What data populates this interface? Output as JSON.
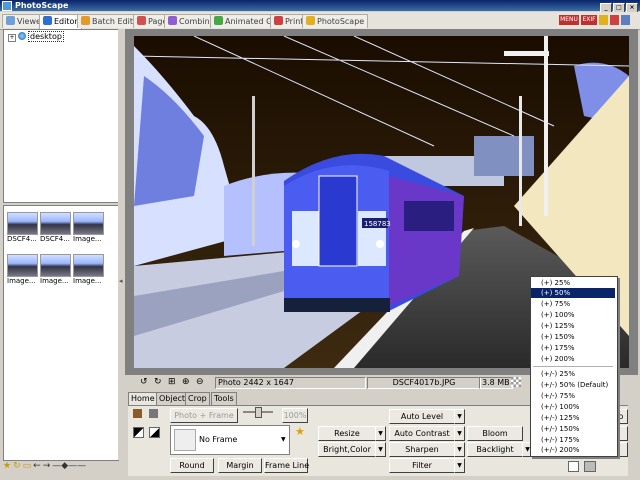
{
  "window": {
    "title": "PhotoScape"
  },
  "tabs": [
    {
      "label": "Viewer",
      "color": "#6f9fd8"
    },
    {
      "label": "Editor",
      "color": "#2e6fd1"
    },
    {
      "label": "Batch Editor",
      "color": "#e39a2b"
    },
    {
      "label": "Page",
      "color": "#d15050"
    },
    {
      "label": "Combine",
      "color": "#8f5fd1"
    },
    {
      "label": "Animated GIF",
      "color": "#45a845"
    },
    {
      "label": "Print",
      "color": "#d14040"
    },
    {
      "label": "PhotoScape",
      "color": "#e0b020"
    }
  ],
  "top_icons": {
    "menu": "MENU",
    "exif": "EXIF"
  },
  "explorer": {
    "root": "desktop"
  },
  "thumbnails": [
    "DSCF4...",
    "DSCF4...",
    "Image...",
    "Image...",
    "Image...",
    "Image..."
  ],
  "status": {
    "dimensions": "Photo 2442 x 1647",
    "filename": "DSCF4017b.JPG",
    "filesize": "3.8 MB"
  },
  "train_number": "158783",
  "edit_tabs": [
    "Home",
    "Object",
    "Crop",
    "Tools"
  ],
  "home": {
    "photo_frame": "Photo + Frame",
    "zoom_pct": "100%",
    "frame_value": "No Frame",
    "round": "Round",
    "margin": "Margin",
    "frame_line": "Frame Line",
    "resize": "Resize",
    "bright_color": "Bright,Color",
    "auto_level": "Auto Level",
    "auto_contrast": "Auto Contrast",
    "sharpen": "Sharpen",
    "filter": "Filter",
    "bloom": "Bloom",
    "backlight": "Backlight",
    "redo_partial": "edo"
  },
  "zoom_menu": {
    "group1": [
      "(+) 25%",
      "(+) 50%",
      "(+) 75%",
      "(+) 100%",
      "(+) 125%",
      "(+) 150%",
      "(+) 175%",
      "(+) 200%"
    ],
    "group2": [
      "(+/-) 25%",
      "(+/-) 50% (Default)",
      "(+/-) 75%",
      "(+/-) 100%",
      "(+/-) 125%",
      "(+/-) 150%",
      "(+/-) 175%",
      "(+/-) 200%"
    ],
    "highlighted": "(+) 50%"
  },
  "colors": {
    "title_bar": "#0a246a",
    "highlight": "#0a246a",
    "background": "#d4d0c8"
  }
}
